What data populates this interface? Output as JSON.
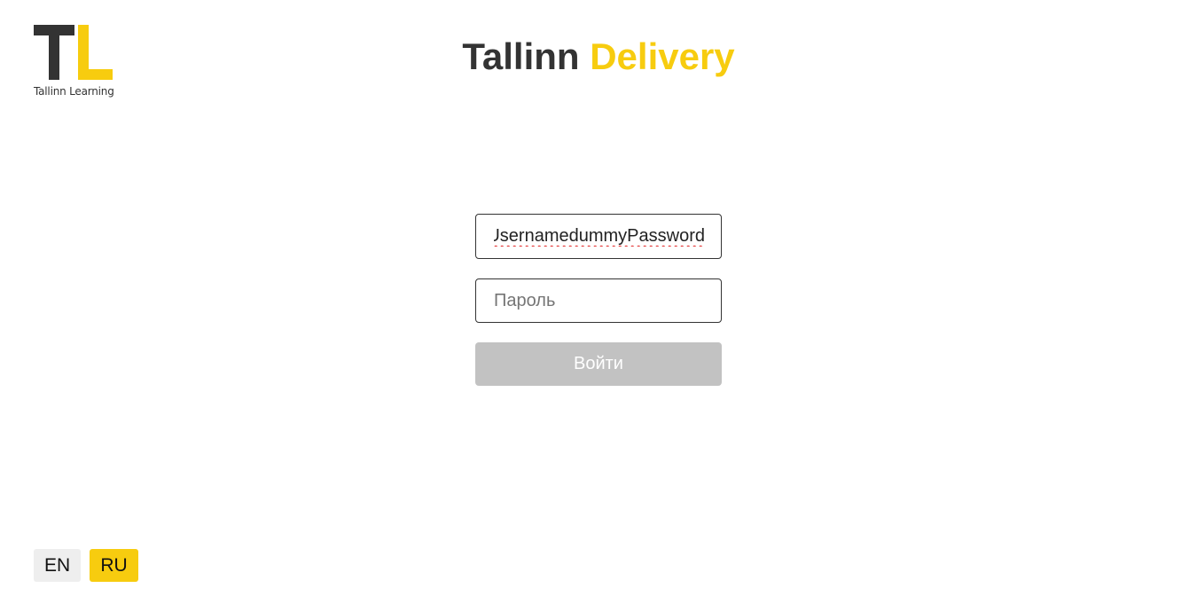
{
  "logo": {
    "letters": "TL",
    "caption": "Tallinn Learning",
    "colors": {
      "dark": "#333333",
      "accent": "#f7cc0f"
    }
  },
  "header": {
    "title_main": "Tallinn",
    "title_accent": "Delivery"
  },
  "login_form": {
    "username_value": "dummyUsernamedummyPassword",
    "password_placeholder": "Пароль",
    "submit_label": "Войти"
  },
  "language_switch": {
    "items": [
      {
        "label": "EN",
        "active": false
      },
      {
        "label": "RU",
        "active": true
      }
    ]
  },
  "colors": {
    "accent": "#f7cc0f",
    "text_dark": "#333333",
    "button_disabled": "#c2c2c2"
  }
}
